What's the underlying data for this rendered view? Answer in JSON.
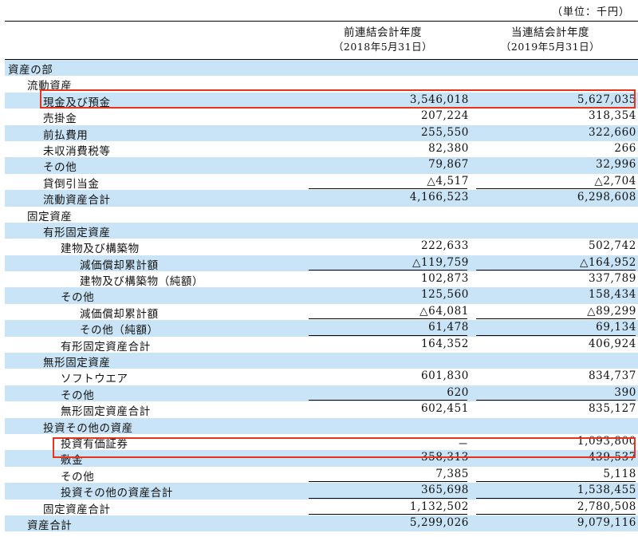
{
  "unit_label": "（単位：千円）",
  "columns": [
    {
      "title": "前連結会計年度",
      "period": "（2018年5月31日）"
    },
    {
      "title": "当連結会計年度",
      "period": "（2019年5月31日）"
    }
  ],
  "rows": [
    {
      "label": "資産の部",
      "level": 0,
      "v1": "",
      "v2": "",
      "underline": false
    },
    {
      "label": "流動資産",
      "level": 1,
      "v1": "",
      "v2": "",
      "underline": false
    },
    {
      "label": "現金及び預金",
      "level": 2,
      "v1": "3,546,018",
      "v2": "5,627,035",
      "underline": false
    },
    {
      "label": "売掛金",
      "level": 2,
      "v1": "207,224",
      "v2": "318,354",
      "underline": false
    },
    {
      "label": "前払費用",
      "level": 2,
      "v1": "255,550",
      "v2": "322,660",
      "underline": false
    },
    {
      "label": "未収消費税等",
      "level": 2,
      "v1": "82,380",
      "v2": "266",
      "underline": false
    },
    {
      "label": "その他",
      "level": 2,
      "v1": "79,867",
      "v2": "32,996",
      "underline": false
    },
    {
      "label": "貸倒引当金",
      "level": 2,
      "v1": "△4,517",
      "v2": "△2,704",
      "underline": true
    },
    {
      "label": "流動資産合計",
      "level": 2,
      "v1": "4,166,523",
      "v2": "6,298,608",
      "underline": false
    },
    {
      "label": "固定資産",
      "level": 1,
      "v1": "",
      "v2": "",
      "underline": false
    },
    {
      "label": "有形固定資産",
      "level": 2,
      "v1": "",
      "v2": "",
      "underline": false
    },
    {
      "label": "建物及び構築物",
      "level": 3,
      "v1": "222,633",
      "v2": "502,742",
      "underline": false
    },
    {
      "label": "減価償却累計額",
      "level": 4,
      "v1": "△119,759",
      "v2": "△164,952",
      "underline": true
    },
    {
      "label": "建物及び構築物（純額）",
      "level": 4,
      "v1": "102,873",
      "v2": "337,789",
      "underline": false
    },
    {
      "label": "その他",
      "level": 3,
      "v1": "125,560",
      "v2": "158,434",
      "underline": false
    },
    {
      "label": "減価償却累計額",
      "level": 4,
      "v1": "△64,081",
      "v2": "△89,299",
      "underline": true
    },
    {
      "label": "その他（純額）",
      "level": 4,
      "v1": "61,478",
      "v2": "69,134",
      "underline": true
    },
    {
      "label": "有形固定資産合計",
      "level": 3,
      "v1": "164,352",
      "v2": "406,924",
      "underline": false
    },
    {
      "label": "無形固定資産",
      "level": 2,
      "v1": "",
      "v2": "",
      "underline": false
    },
    {
      "label": "ソフトウエア",
      "level": 3,
      "v1": "601,830",
      "v2": "834,737",
      "underline": false
    },
    {
      "label": "その他",
      "level": 3,
      "v1": "620",
      "v2": "390",
      "underline": true
    },
    {
      "label": "無形固定資産合計",
      "level": 3,
      "v1": "602,451",
      "v2": "835,127",
      "underline": false
    },
    {
      "label": "投資その他の資産",
      "level": 2,
      "v1": "",
      "v2": "",
      "underline": false
    },
    {
      "label": "投資有価証券",
      "level": 3,
      "v1": "－",
      "v2": "1,093,800",
      "underline": false
    },
    {
      "label": "敷金",
      "level": 3,
      "v1": "358,313",
      "v2": "439,537",
      "underline": false
    },
    {
      "label": "その他",
      "level": 3,
      "v1": "7,385",
      "v2": "5,118",
      "underline": true
    },
    {
      "label": "投資その他の資産合計",
      "level": 3,
      "v1": "365,698",
      "v2": "1,538,455",
      "underline": true
    },
    {
      "label": "固定資産合計",
      "level": 2,
      "v1": "1,132,502",
      "v2": "2,780,508",
      "underline": true
    },
    {
      "label": "資産合計",
      "level": 1,
      "v1": "5,299,026",
      "v2": "9,079,116",
      "underline": false
    }
  ],
  "highlight_color": "#e8341c",
  "row_shade_color": "#c9e4f6"
}
